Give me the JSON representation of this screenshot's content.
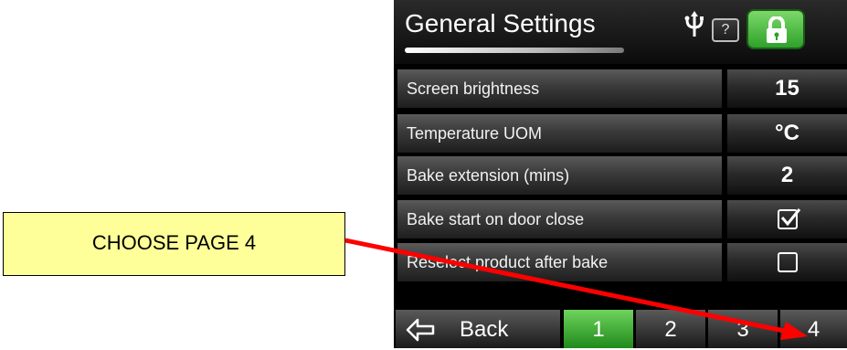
{
  "header": {
    "title": "General Settings",
    "usb_icon": "usb-icon",
    "help_label": "?",
    "lock_icon": "lock-icon"
  },
  "settings": [
    {
      "label": "Screen brightness",
      "value": "15"
    },
    {
      "label": "Temperature UOM",
      "value": "°C"
    },
    {
      "label": "Bake extension (mins)",
      "value": "2"
    },
    {
      "label": "Bake start on door close",
      "value": "checked"
    },
    {
      "label": "Reselect product after bake",
      "value": "unchecked"
    }
  ],
  "footer": {
    "back_label": "Back",
    "pages": [
      "1",
      "2",
      "3",
      "4"
    ],
    "active_page": "1"
  },
  "annotation": {
    "callout_text": "CHOOSE PAGE 4",
    "callout_color": "#ffff99",
    "arrow_color": "#ff0000"
  },
  "colors": {
    "active_green": "#2fa12a",
    "panel_bg": "#000000"
  }
}
